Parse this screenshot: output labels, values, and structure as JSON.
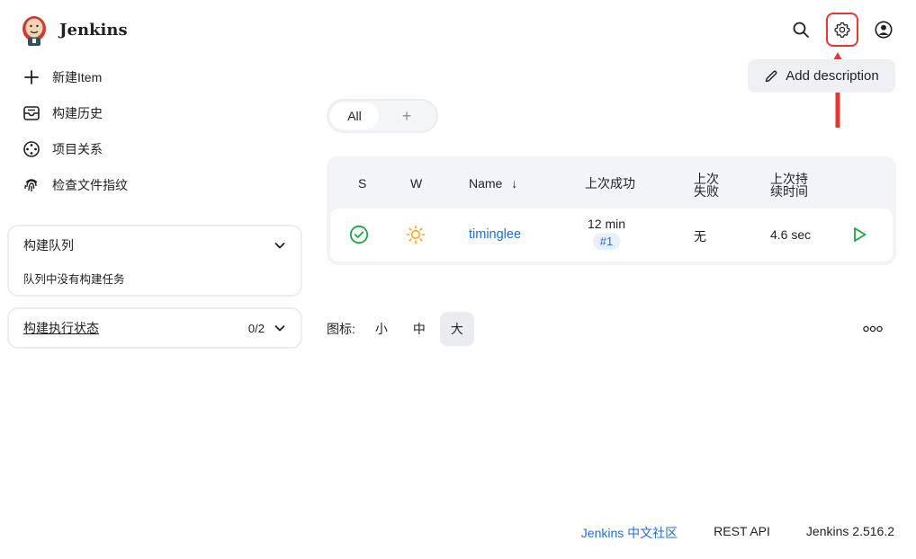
{
  "header": {
    "brand": "Jenkins",
    "search_icon": "search-icon",
    "settings_icon": "gear-icon",
    "account_icon": "user-circle-icon",
    "highlight_color": "#e5372f"
  },
  "sidebar": {
    "tasks": [
      {
        "label": "新建Item",
        "icon": "plus-icon"
      },
      {
        "label": "构建历史",
        "icon": "inbox-icon"
      },
      {
        "label": "项目关系",
        "icon": "relationship-icon"
      },
      {
        "label": "检查文件指纹",
        "icon": "fingerprint-icon"
      }
    ],
    "queue": {
      "title": "构建队列",
      "empty": "队列中没有构建任务"
    },
    "executors": {
      "title": "构建执行状态",
      "count": "0/2"
    }
  },
  "main": {
    "add_description": "Add description",
    "tabs": {
      "all": "All",
      "add": "+"
    },
    "table": {
      "headers": {
        "s": "S",
        "w": "W",
        "name": "Name",
        "sort_arrow": "↓",
        "last_success": "上次成功",
        "last_failure_1": "上次",
        "last_failure_2": "失败",
        "last_duration_1": "上次持",
        "last_duration_2": "续时间"
      },
      "rows": [
        {
          "status": "success",
          "weather": "sunny",
          "name": "timinglee",
          "last_success": "12 min",
          "build": "#1",
          "last_failure": "无",
          "last_duration": "4.6 sec"
        }
      ]
    },
    "icon_size": {
      "label": "图标:",
      "small": "小",
      "medium": "中",
      "large": "大",
      "selected": "大"
    }
  },
  "footer": {
    "community": "Jenkins 中文社区",
    "rest_api": "REST API",
    "version": "Jenkins 2.516.2"
  },
  "colors": {
    "link": "#1f6fd1",
    "success": "#1ea446",
    "sunny": "#f5a524"
  }
}
